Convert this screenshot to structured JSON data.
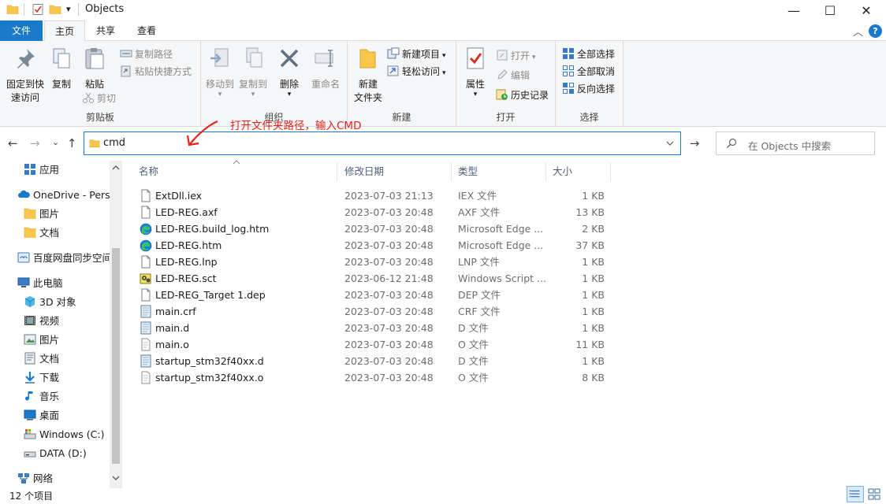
{
  "window": {
    "title": "Objects",
    "qa_dropdown": "▾",
    "minimize": "—",
    "maximize": "☐",
    "close": "✕",
    "ribbon_collapse": "︿",
    "help": "?"
  },
  "tabs": {
    "file": "文件",
    "home": "主页",
    "share": "共享",
    "view": "查看"
  },
  "ribbon": {
    "clipboard": {
      "label": "剪贴板",
      "pin_line1": "固定到快",
      "pin_line2": "速访问",
      "copy": "复制",
      "paste": "粘贴",
      "copy_path": "复制路径",
      "paste_shortcut": "粘贴快捷方式",
      "cut": "剪切"
    },
    "organize": {
      "label": "组织",
      "move_to": "移动到",
      "copy_to": "复制到",
      "delete": "删除",
      "rename": "重命名"
    },
    "new": {
      "label": "新建",
      "new_folder_line1": "新建",
      "new_folder_line2": "文件夹",
      "new_item": "新建项目",
      "easy_access": "轻松访问"
    },
    "open": {
      "label": "打开",
      "properties": "属性",
      "open": "打开",
      "edit": "编辑",
      "history": "历史记录"
    },
    "select": {
      "label": "选择",
      "select_all": "全部选择",
      "select_none": "全部取消",
      "invert": "反向选择"
    }
  },
  "nav": {
    "back": "←",
    "forward": "→",
    "recent": "⌄",
    "up": "↑",
    "address": "cmd",
    "go": "→",
    "search_placeholder": "在 Objects 中搜索"
  },
  "annotation": "打开文件夹路径，输入CMD",
  "sidebar": [
    {
      "label": "应用",
      "icon": "apps-icon"
    },
    {
      "label": "OneDrive - Perso",
      "icon": "cloud-icon"
    },
    {
      "label": "图片",
      "icon": "folder-icon"
    },
    {
      "label": "文档",
      "icon": "folder-icon"
    },
    {
      "label": "百度网盘同步空间",
      "icon": "baidu-icon"
    },
    {
      "label": "此电脑",
      "icon": "pc-icon"
    },
    {
      "label": "3D 对象",
      "icon": "cube-icon"
    },
    {
      "label": "视频",
      "icon": "video-icon"
    },
    {
      "label": "图片",
      "icon": "pictures-icon"
    },
    {
      "label": "文档",
      "icon": "documents-icon"
    },
    {
      "label": "下载",
      "icon": "download-icon"
    },
    {
      "label": "音乐",
      "icon": "music-icon"
    },
    {
      "label": "桌面",
      "icon": "desktop-icon"
    },
    {
      "label": "Windows (C:)",
      "icon": "drive-c-icon"
    },
    {
      "label": "DATA (D:)",
      "icon": "drive-icon"
    },
    {
      "label": "网络",
      "icon": "network-icon"
    }
  ],
  "columns": {
    "name": "名称",
    "date": "修改日期",
    "type": "类型",
    "size": "大小"
  },
  "files": [
    {
      "name": "ExtDll.iex",
      "date": "2023-07-03 21:13",
      "type": "IEX 文件",
      "size": "1 KB",
      "icon": "file-icon"
    },
    {
      "name": "LED-REG.axf",
      "date": "2023-07-03 20:48",
      "type": "AXF 文件",
      "size": "13 KB",
      "icon": "file-icon"
    },
    {
      "name": "LED-REG.build_log.htm",
      "date": "2023-07-03 20:48",
      "type": "Microsoft Edge ...",
      "size": "2 KB",
      "icon": "edge-icon"
    },
    {
      "name": "LED-REG.htm",
      "date": "2023-07-03 20:48",
      "type": "Microsoft Edge ...",
      "size": "37 KB",
      "icon": "edge-icon"
    },
    {
      "name": "LED-REG.lnp",
      "date": "2023-07-03 20:48",
      "type": "LNP 文件",
      "size": "1 KB",
      "icon": "file-icon"
    },
    {
      "name": "LED-REG.sct",
      "date": "2023-06-12 21:48",
      "type": "Windows Script ...",
      "size": "1 KB",
      "icon": "script-icon"
    },
    {
      "name": "LED-REG_Target 1.dep",
      "date": "2023-07-03 20:48",
      "type": "DEP 文件",
      "size": "1 KB",
      "icon": "file-icon"
    },
    {
      "name": "main.crf",
      "date": "2023-07-03 20:48",
      "type": "CRF 文件",
      "size": "1 KB",
      "icon": "data-file-icon"
    },
    {
      "name": "main.d",
      "date": "2023-07-03 20:48",
      "type": "D 文件",
      "size": "1 KB",
      "icon": "data-file-icon"
    },
    {
      "name": "main.o",
      "date": "2023-07-03 20:48",
      "type": "O 文件",
      "size": "11 KB",
      "icon": "text-file-icon"
    },
    {
      "name": "startup_stm32f40xx.d",
      "date": "2023-07-03 20:48",
      "type": "D 文件",
      "size": "1 KB",
      "icon": "data-file-icon"
    },
    {
      "name": "startup_stm32f40xx.o",
      "date": "2023-07-03 20:48",
      "type": "O 文件",
      "size": "8 KB",
      "icon": "text-file-icon"
    }
  ],
  "status": {
    "item_count": "12 个项目"
  },
  "colors": {
    "accent": "#1979ca",
    "annotation": "#e8221c",
    "folder": "#f8c74a"
  }
}
